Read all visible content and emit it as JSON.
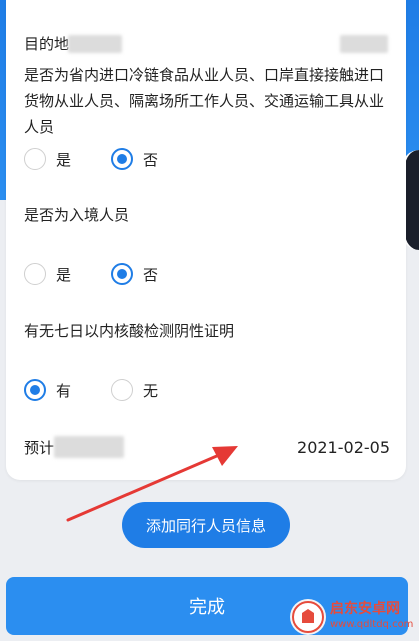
{
  "form": {
    "destination_label": "目的地",
    "q1": {
      "question": "是否为省内进口冷链食品从业人员、口岸直接接触进口货物从业人员、隔离场所工作人员、交通运输工具从业人员",
      "options": [
        "是",
        "否"
      ],
      "selected": "否"
    },
    "q2": {
      "question": "是否为入境人员",
      "options": [
        "是",
        "否"
      ],
      "selected": "否"
    },
    "q3": {
      "question": "有无七日以内核酸检测阴性证明",
      "options": [
        "有",
        "无"
      ],
      "selected": "有"
    },
    "expected_label": "预计",
    "expected_date": "2021-02-05"
  },
  "buttons": {
    "add_companion": "添加同行人员信息",
    "done": "完成"
  },
  "watermark": {
    "title": "启东安卓网",
    "url": "www.qdltdq.com"
  },
  "colors": {
    "accent": "#1f7de6",
    "annotation": "#e53935"
  }
}
